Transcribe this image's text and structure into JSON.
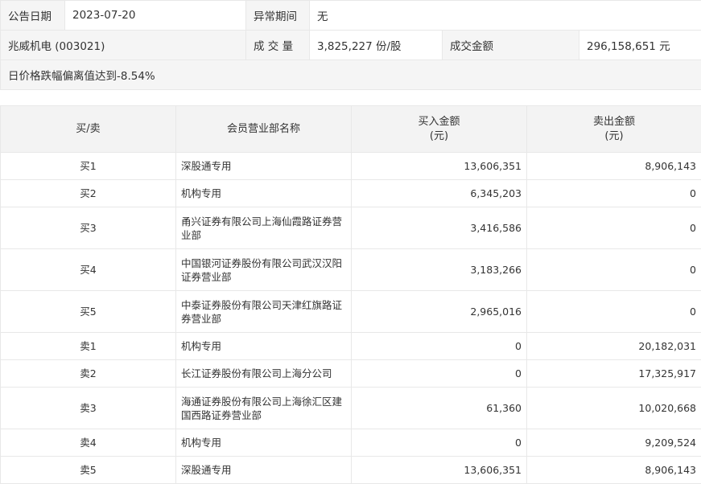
{
  "header": {
    "date_label": "公告日期",
    "date_value": "2023-07-20",
    "period_label": "异常期间",
    "period_value": "无",
    "stock": "兆威机电 (003021)",
    "volume_label": "成 交 量",
    "volume_value": "3,825,227 份/股",
    "amount_label": "成交金额",
    "amount_value": "296,158,651 元",
    "reason": "日价格跌幅偏离值达到-8.54%"
  },
  "table": {
    "col_side": "买/卖",
    "col_name": "会员营业部名称",
    "col_buy": "买入金额",
    "col_sell": "卖出金额",
    "unit": "(元)",
    "rows": [
      {
        "side": "买1",
        "name": "深股通专用",
        "buy": "13,606,351",
        "sell": "8,906,143"
      },
      {
        "side": "买2",
        "name": "机构专用",
        "buy": "6,345,203",
        "sell": "0"
      },
      {
        "side": "买3",
        "name": "甬兴证券有限公司上海仙霞路证券营业部",
        "buy": "3,416,586",
        "sell": "0"
      },
      {
        "side": "买4",
        "name": "中国银河证券股份有限公司武汉汉阳证券营业部",
        "buy": "3,183,266",
        "sell": "0"
      },
      {
        "side": "买5",
        "name": "中泰证券股份有限公司天津红旗路证券营业部",
        "buy": "2,965,016",
        "sell": "0"
      },
      {
        "side": "卖1",
        "name": "机构专用",
        "buy": "0",
        "sell": "20,182,031"
      },
      {
        "side": "卖2",
        "name": "长江证券股份有限公司上海分公司",
        "buy": "0",
        "sell": "17,325,917"
      },
      {
        "side": "卖3",
        "name": "海通证券股份有限公司上海徐汇区建国西路证券营业部",
        "buy": "61,360",
        "sell": "10,020,668"
      },
      {
        "side": "卖4",
        "name": "机构专用",
        "buy": "0",
        "sell": "9,209,524"
      },
      {
        "side": "卖5",
        "name": "深股通专用",
        "buy": "13,606,351",
        "sell": "8,906,143"
      }
    ]
  }
}
